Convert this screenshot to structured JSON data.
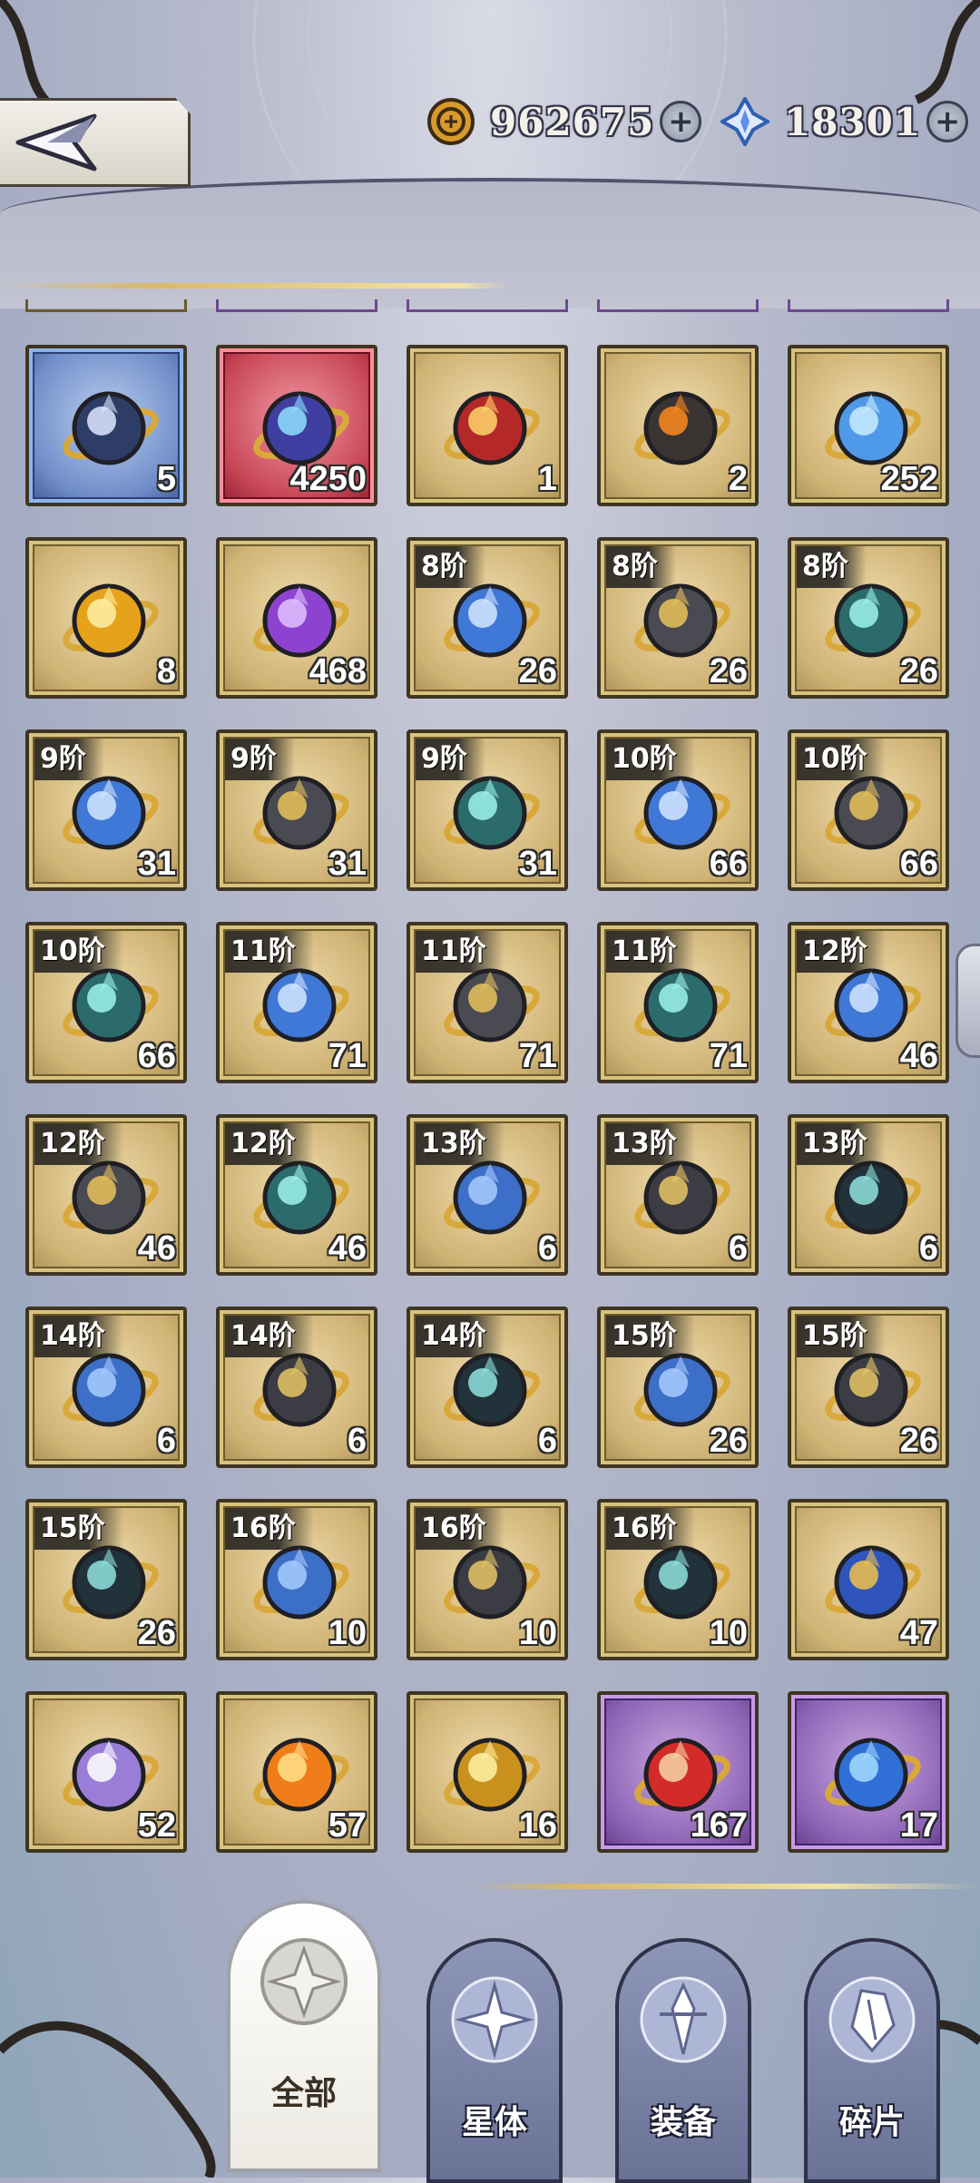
{
  "currencies": {
    "gold": {
      "amount": "962675",
      "icon": "coin-icon"
    },
    "gem": {
      "amount": "18301",
      "icon": "diamond-gem-icon"
    }
  },
  "items": [
    {
      "tier": "",
      "count": "5",
      "rarity": "blue",
      "icon": "star-wolf-icon"
    },
    {
      "tier": "",
      "count": "4250",
      "rarity": "red",
      "icon": "blue-flame-potion-icon"
    },
    {
      "tier": "",
      "count": "1",
      "rarity": "gold",
      "icon": "red-crystal-icon"
    },
    {
      "tier": "",
      "count": "2",
      "rarity": "gold",
      "icon": "fire-stone-icon"
    },
    {
      "tier": "",
      "count": "252",
      "rarity": "gold",
      "icon": "blue-orb-icon"
    },
    {
      "tier": "",
      "count": "8",
      "rarity": "gold",
      "icon": "gold-orb-icon"
    },
    {
      "tier": "",
      "count": "468",
      "rarity": "gold",
      "icon": "purple-ribbon-icon"
    },
    {
      "tier": "8阶",
      "count": "26",
      "rarity": "gold",
      "icon": "blue-gem-icon"
    },
    {
      "tier": "8阶",
      "count": "26",
      "rarity": "gold",
      "icon": "dark-crystal-icon"
    },
    {
      "tier": "8阶",
      "count": "26",
      "rarity": "gold",
      "icon": "spiral-orb-icon"
    },
    {
      "tier": "9阶",
      "count": "31",
      "rarity": "gold",
      "icon": "blue-gem-icon"
    },
    {
      "tier": "9阶",
      "count": "31",
      "rarity": "gold",
      "icon": "dark-crystal-icon"
    },
    {
      "tier": "9阶",
      "count": "31",
      "rarity": "gold",
      "icon": "spiral-orb-icon"
    },
    {
      "tier": "10阶",
      "count": "66",
      "rarity": "gold",
      "icon": "blue-gem-icon"
    },
    {
      "tier": "10阶",
      "count": "66",
      "rarity": "gold",
      "icon": "dark-crystal-icon"
    },
    {
      "tier": "10阶",
      "count": "66",
      "rarity": "gold",
      "icon": "spiral-orb-icon"
    },
    {
      "tier": "11阶",
      "count": "71",
      "rarity": "gold",
      "icon": "blue-gem-icon"
    },
    {
      "tier": "11阶",
      "count": "71",
      "rarity": "gold",
      "icon": "dark-crystal-icon"
    },
    {
      "tier": "11阶",
      "count": "71",
      "rarity": "gold",
      "icon": "spiral-orb-icon"
    },
    {
      "tier": "12阶",
      "count": "46",
      "rarity": "gold",
      "icon": "blue-gem-icon"
    },
    {
      "tier": "12阶",
      "count": "46",
      "rarity": "gold",
      "icon": "dark-crystal-icon"
    },
    {
      "tier": "12阶",
      "count": "46",
      "rarity": "gold",
      "icon": "spiral-orb-icon"
    },
    {
      "tier": "13阶",
      "count": "6",
      "rarity": "gold",
      "icon": "blue-sphere-icon"
    },
    {
      "tier": "13阶",
      "count": "6",
      "rarity": "gold",
      "icon": "dark-triangle-crystal-icon"
    },
    {
      "tier": "13阶",
      "count": "6",
      "rarity": "gold",
      "icon": "dark-spiral-orb-icon"
    },
    {
      "tier": "14阶",
      "count": "6",
      "rarity": "gold",
      "icon": "blue-sphere-icon"
    },
    {
      "tier": "14阶",
      "count": "6",
      "rarity": "gold",
      "icon": "dark-triangle-crystal-icon"
    },
    {
      "tier": "14阶",
      "count": "6",
      "rarity": "gold",
      "icon": "dark-spiral-orb-icon"
    },
    {
      "tier": "15阶",
      "count": "26",
      "rarity": "gold",
      "icon": "blue-sphere-icon"
    },
    {
      "tier": "15阶",
      "count": "26",
      "rarity": "gold",
      "icon": "dark-triangle-crystal-icon"
    },
    {
      "tier": "15阶",
      "count": "26",
      "rarity": "gold",
      "icon": "dark-spiral-orb-icon"
    },
    {
      "tier": "16阶",
      "count": "10",
      "rarity": "gold",
      "icon": "blue-sphere-icon"
    },
    {
      "tier": "16阶",
      "count": "10",
      "rarity": "gold",
      "icon": "dark-triangle-crystal-icon"
    },
    {
      "tier": "16阶",
      "count": "10",
      "rarity": "gold",
      "icon": "dark-spiral-orb-icon"
    },
    {
      "tier": "",
      "count": "47",
      "rarity": "gold",
      "icon": "blue-flame-torch-icon"
    },
    {
      "tier": "",
      "count": "52",
      "rarity": "gold",
      "icon": "purple-flower-icon"
    },
    {
      "tier": "",
      "count": "57",
      "rarity": "gold",
      "icon": "orange-lotus-icon"
    },
    {
      "tier": "",
      "count": "16",
      "rarity": "gold",
      "icon": "gold-crystal-icon"
    },
    {
      "tier": "",
      "count": "167",
      "rarity": "purple",
      "icon": "red-apple-icon"
    },
    {
      "tier": "",
      "count": "17",
      "rarity": "purple",
      "icon": "blue-potion-bottle-icon"
    }
  ],
  "tabs": [
    {
      "label": "全部",
      "active": true,
      "icon": "all-emblem-icon"
    },
    {
      "label": "星体",
      "active": false,
      "icon": "star-emblem-icon"
    },
    {
      "label": "装备",
      "active": false,
      "icon": "equipment-emblem-icon"
    },
    {
      "label": "碎片",
      "active": false,
      "icon": "fragment-emblem-icon"
    }
  ]
}
